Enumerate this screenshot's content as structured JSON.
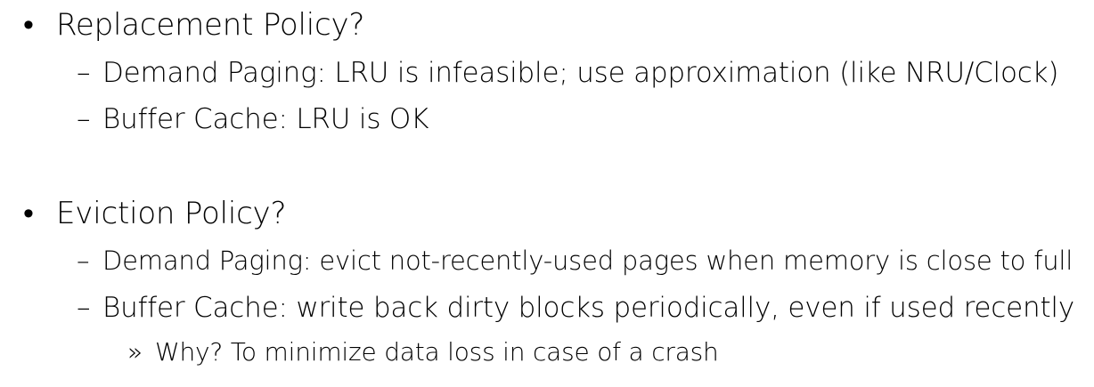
{
  "sections": [
    {
      "bullet": "•",
      "heading": "Replacement Policy?",
      "items": [
        {
          "marker": "–",
          "text": "Demand Paging: LRU is infeasible; use approximation (like NRU/Clock)"
        },
        {
          "marker": "–",
          "text": "Buffer Cache: LRU is OK"
        }
      ]
    },
    {
      "bullet": "•",
      "heading": "Eviction Policy?",
      "items": [
        {
          "marker": "–",
          "text": "Demand Paging: evict not-recently-used pages when memory is close to full"
        },
        {
          "marker": "–",
          "text": "Buffer Cache: write back dirty blocks periodically, even if used recently",
          "subitems": [
            {
              "marker": "»",
              "text": "Why? To minimize data loss in case of a crash"
            }
          ]
        }
      ]
    }
  ]
}
